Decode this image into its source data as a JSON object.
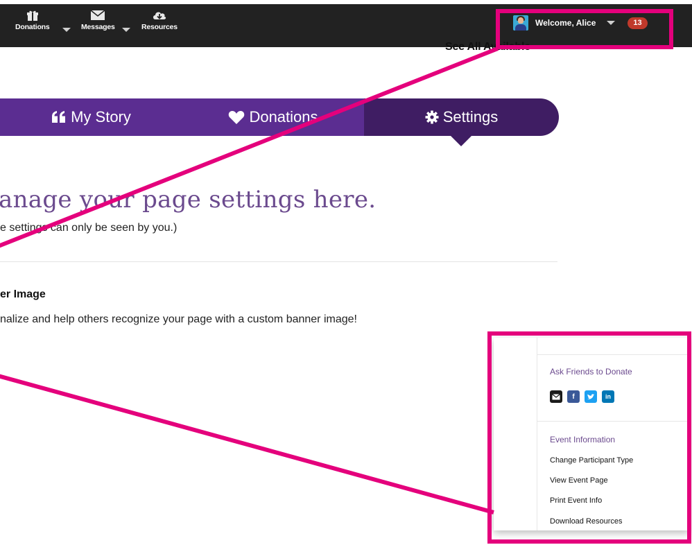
{
  "topbar": {
    "nav": [
      {
        "label": "Donations",
        "icon": "gift-icon"
      },
      {
        "label": "Messages",
        "icon": "envelope-icon"
      },
      {
        "label": "Resources",
        "icon": "cloud-download-icon"
      }
    ],
    "welcome": "Welcome, Alice",
    "badge_count": "13"
  },
  "see_all": "See All Available›",
  "tabs": [
    {
      "label": "My Story",
      "icon": "quote-icon"
    },
    {
      "label": "Donations",
      "icon": "heart-icon"
    },
    {
      "label": "Settings",
      "icon": "gear-icon"
    }
  ],
  "main": {
    "headline": "anage your page settings here.",
    "subline": "e settings can only be seen by you.)",
    "section_title": "er Image",
    "section_desc": "nalize and help others recognize your page with a custom banner image!"
  },
  "side_panel": {
    "share_heading": "Ask Friends to Donate",
    "share_buttons": [
      {
        "icon": "email-icon",
        "color": "#1b1b1b"
      },
      {
        "icon": "facebook-icon",
        "color": "#3b5998"
      },
      {
        "icon": "twitter-icon",
        "color": "#1da1f2"
      },
      {
        "icon": "linkedin-icon",
        "color": "#0077b5"
      }
    ],
    "event_heading": "Event Information",
    "event_links": [
      "Change Participant Type",
      "View Event Page",
      "Print Event Info",
      "Download Resources"
    ]
  },
  "colors": {
    "tab_purple": "#5b2d91",
    "tab_active": "#3f1d63",
    "annotation": "#e4007c",
    "badge": "#c0392b"
  }
}
